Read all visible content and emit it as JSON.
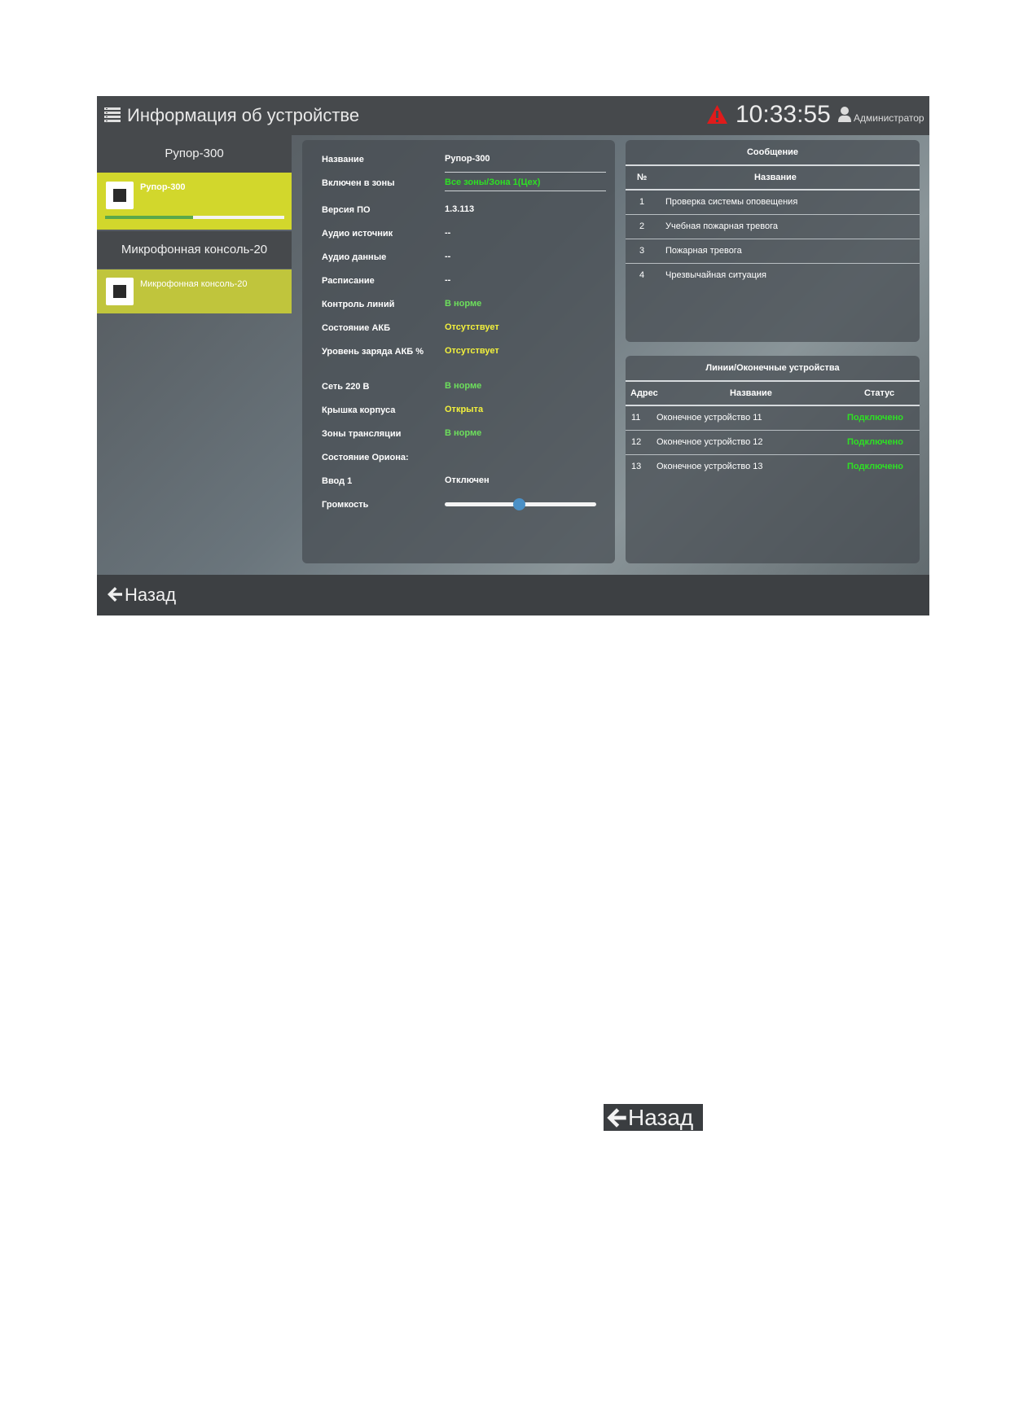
{
  "header": {
    "title": "Информация об устройстве",
    "clock": "10:33:55",
    "user": "Администратор",
    "alarm_color": "#e01b1b"
  },
  "sidebar": {
    "devices": [
      {
        "header": "Рупор-300",
        "tile_label": "Рупор-300",
        "progress": 0.49
      },
      {
        "header": "Микрофонная консоль-20",
        "tile_label": "Микрофонная консоль-20"
      }
    ]
  },
  "info": {
    "rows": [
      {
        "label": "Название",
        "value": "Рупор-300"
      },
      {
        "label": "Включен в зоны",
        "value": "Все зоны/Зона 1(Цех)"
      },
      {
        "label": "Версия ПО",
        "value": "1.3.113"
      },
      {
        "label": "Аудио источник",
        "value": "--"
      },
      {
        "label": "Аудио данные",
        "value": "--"
      },
      {
        "label": "Расписание",
        "value": "--"
      },
      {
        "label": "Контроль линий",
        "value": "В норме"
      },
      {
        "label": "Состояние АКБ",
        "value": "Отсутствует"
      },
      {
        "label": "Уровень заряда АКБ %",
        "value": "Отсутствует"
      },
      {
        "label": "Сеть 220 В",
        "value": "В норме"
      },
      {
        "label": "Крышка корпуса",
        "value": "Открыта"
      },
      {
        "label": "Зоны трансляции",
        "value": "В норме"
      },
      {
        "label": "Состояние Ориона:",
        "value": ""
      },
      {
        "label": "Ввод 1",
        "value": "Отключен"
      },
      {
        "label": "Громкость",
        "value": ""
      }
    ],
    "volume": 0.49
  },
  "messages": {
    "title": "Сообщение",
    "col_num": "№",
    "col_name": "Название",
    "rows": [
      {
        "num": "1",
        "name": "Проверка системы оповещения"
      },
      {
        "num": "2",
        "name": "Учебная пожарная тревога"
      },
      {
        "num": "3",
        "name": "Пожарная тревога"
      },
      {
        "num": "4",
        "name": "Чрезвычайная ситуация"
      }
    ]
  },
  "lines": {
    "title": "Линии/Оконечные устройства",
    "col_addr": "Адрес",
    "col_name": "Название",
    "col_status": "Статус",
    "rows": [
      {
        "addr": "11",
        "name": "Оконечное устройство 11",
        "status": "Подключено"
      },
      {
        "addr": "12",
        "name": "Оконечное устройство 12",
        "status": "Подключено"
      },
      {
        "addr": "13",
        "name": "Оконечное устройство 13",
        "status": "Подключено"
      }
    ]
  },
  "footer": {
    "back_label": "Назад"
  },
  "standalone_button": {
    "label": "Назад"
  }
}
